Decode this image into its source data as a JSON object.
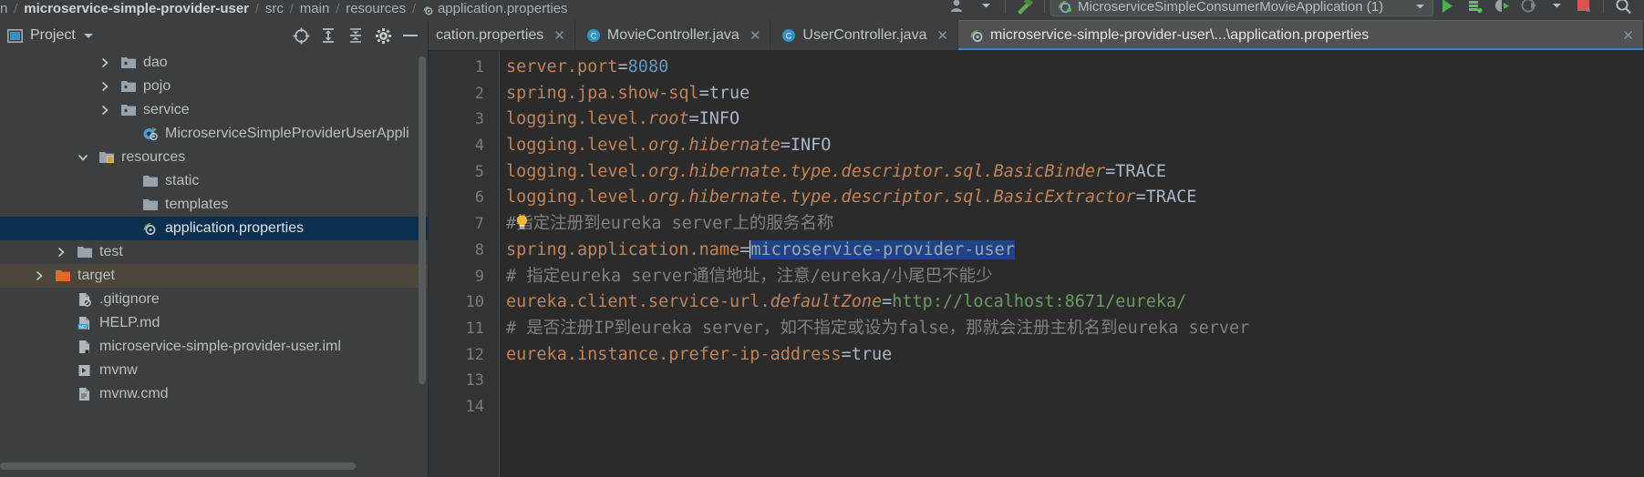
{
  "breadcrumb": {
    "items": [
      {
        "label": "n",
        "bold": false
      },
      {
        "label": "microservice-simple-provider-user",
        "bold": true
      },
      {
        "label": "src",
        "bold": false
      },
      {
        "label": "main",
        "bold": false
      },
      {
        "label": "resources",
        "bold": false
      },
      {
        "label": "application.properties",
        "bold": false,
        "icon": "properties-file-icon"
      }
    ],
    "separator": "/"
  },
  "toolbar": {
    "profile_icon": "user-profile-icon",
    "profile_dropdown_icon": "chevron-down-icon",
    "build_icon": "hammer-icon",
    "run_config": {
      "icon": "spring-boot-run-icon",
      "label": "MicroserviceSimpleConsumerMovieApplication (1)",
      "dropdown_icon": "chevron-down-icon"
    },
    "run_icon": "run-play-icon",
    "debug_icon": "debug-bug-icon",
    "run_with_coverage_icon": "run-coverage-icon",
    "profiler_icon": "profiler-icon",
    "profiler_dropdown_icon": "chevron-down-icon",
    "stop_icon": "stop-square-icon",
    "search_icon": "search-magnifier-icon"
  },
  "project_panel": {
    "title": "Project",
    "title_dropdown_icon": "chevron-down-icon",
    "actions": [
      {
        "name": "locate-in-tree-icon"
      },
      {
        "name": "expand-all-icon"
      },
      {
        "name": "collapse-all-icon"
      },
      {
        "name": "settings-gear-icon"
      },
      {
        "name": "hide-panel-icon"
      }
    ],
    "tree": [
      {
        "label": "dao",
        "indent": 4,
        "arrow": "right",
        "icon": "package-folder-icon",
        "state": "normal"
      },
      {
        "label": "pojo",
        "indent": 4,
        "arrow": "right",
        "icon": "package-folder-icon",
        "state": "normal"
      },
      {
        "label": "service",
        "indent": 4,
        "arrow": "right",
        "icon": "package-folder-icon",
        "state": "normal"
      },
      {
        "label": "MicroserviceSimpleProviderUserAppli",
        "indent": 5,
        "arrow": "none",
        "icon": "spring-class-icon",
        "state": "normal"
      },
      {
        "label": "resources",
        "indent": 3,
        "arrow": "down",
        "icon": "resources-folder-icon",
        "state": "normal"
      },
      {
        "label": "static",
        "indent": 5,
        "arrow": "none",
        "icon": "folder-icon",
        "state": "normal"
      },
      {
        "label": "templates",
        "indent": 5,
        "arrow": "none",
        "icon": "folder-icon",
        "state": "normal"
      },
      {
        "label": "application.properties",
        "indent": 5,
        "arrow": "none",
        "icon": "properties-file-icon",
        "state": "selected"
      },
      {
        "label": "test",
        "indent": 2,
        "arrow": "right",
        "icon": "folder-icon",
        "state": "normal"
      },
      {
        "label": "target",
        "indent": 1,
        "arrow": "right",
        "icon": "target-folder-icon",
        "state": "highlight"
      },
      {
        "label": ".gitignore",
        "indent": 2,
        "arrow": "none",
        "icon": "gitignore-file-icon",
        "state": "normal"
      },
      {
        "label": "HELP.md",
        "indent": 2,
        "arrow": "none",
        "icon": "markdown-file-icon",
        "state": "normal"
      },
      {
        "label": "microservice-simple-provider-user.iml",
        "indent": 2,
        "arrow": "none",
        "icon": "iml-file-icon",
        "state": "normal"
      },
      {
        "label": "mvnw",
        "indent": 2,
        "arrow": "none",
        "icon": "script-file-icon",
        "state": "normal"
      },
      {
        "label": "mvnw.cmd",
        "indent": 2,
        "arrow": "none",
        "icon": "cmd-file-icon",
        "state": "normal"
      }
    ]
  },
  "editor": {
    "tabs": [
      {
        "label": "cation.properties",
        "icon": "none",
        "active": false,
        "closable": true
      },
      {
        "label": "MovieController.java",
        "icon": "java-class-icon",
        "active": false,
        "closable": true
      },
      {
        "label": "UserController.java",
        "icon": "java-class-icon",
        "active": false,
        "closable": true
      },
      {
        "label": "microservice-simple-provider-user\\...\\application.properties",
        "icon": "properties-file-icon",
        "active": true,
        "closable": true
      }
    ],
    "active_tab_accent": "#3d85c6",
    "line_numbers": [
      1,
      2,
      3,
      4,
      5,
      6,
      7,
      8,
      9,
      10,
      11,
      12,
      13,
      14
    ],
    "lines": [
      {
        "n": 1,
        "type": "prop",
        "key": "server.port",
        "key_italic": "",
        "value": "8080",
        "value_kind": "number"
      },
      {
        "n": 2,
        "type": "prop",
        "key": "spring.jpa.show-sql",
        "key_italic": "",
        "value": "true",
        "value_kind": "plain"
      },
      {
        "n": 3,
        "type": "prop",
        "key": "logging.level.",
        "key_italic": "root",
        "value": "INFO",
        "value_kind": "plain"
      },
      {
        "n": 4,
        "type": "prop",
        "key": "logging.level.",
        "key_italic": "org.hibernate",
        "value": "INFO",
        "value_kind": "plain"
      },
      {
        "n": 5,
        "type": "prop",
        "key": "logging.level.",
        "key_italic": "org.hibernate.type.descriptor.sql.BasicBinder",
        "value": "TRACE",
        "value_kind": "plain"
      },
      {
        "n": 6,
        "type": "prop",
        "key": "logging.level.",
        "key_italic": "org.hibernate.type.descriptor.sql.BasicExtractor",
        "value": "TRACE",
        "value_kind": "plain"
      },
      {
        "n": 7,
        "type": "comment",
        "text": "#指定注册到eureka server上的服务名称",
        "bulb": true
      },
      {
        "n": 8,
        "type": "prop-selected",
        "key": "spring.application.name",
        "key_italic": "",
        "value": "microservice-provider-user",
        "value_kind": "selected"
      },
      {
        "n": 9,
        "type": "comment",
        "text": "# 指定eureka server通信地址，注意/eureka/小尾巴不能少",
        "bulb": false
      },
      {
        "n": 10,
        "type": "prop",
        "key": "eureka.client.service-url.",
        "key_italic": "defaultZone",
        "value": "http://localhost:8671/eureka/",
        "value_kind": "url"
      },
      {
        "n": 11,
        "type": "comment",
        "text": "# 是否注册IP到eureka server，如不指定或设为false，那就会注册主机名到eureka server",
        "bulb": false
      },
      {
        "n": 12,
        "type": "prop",
        "key": "eureka.instance.prefer-ip-address",
        "key_italic": "",
        "value": "true",
        "value_kind": "plain"
      },
      {
        "n": 13,
        "type": "blank"
      },
      {
        "n": 14,
        "type": "blank"
      }
    ],
    "colors": {
      "background": "#2b2b2b",
      "gutter": "#313335",
      "key": "#c0835a",
      "value_string": "#6a9b5e",
      "value_number": "#6897bb",
      "value_plain": "#a9b7c6",
      "comment": "#808080",
      "selection": "#214283",
      "caret": "#e6e6e6"
    }
  }
}
